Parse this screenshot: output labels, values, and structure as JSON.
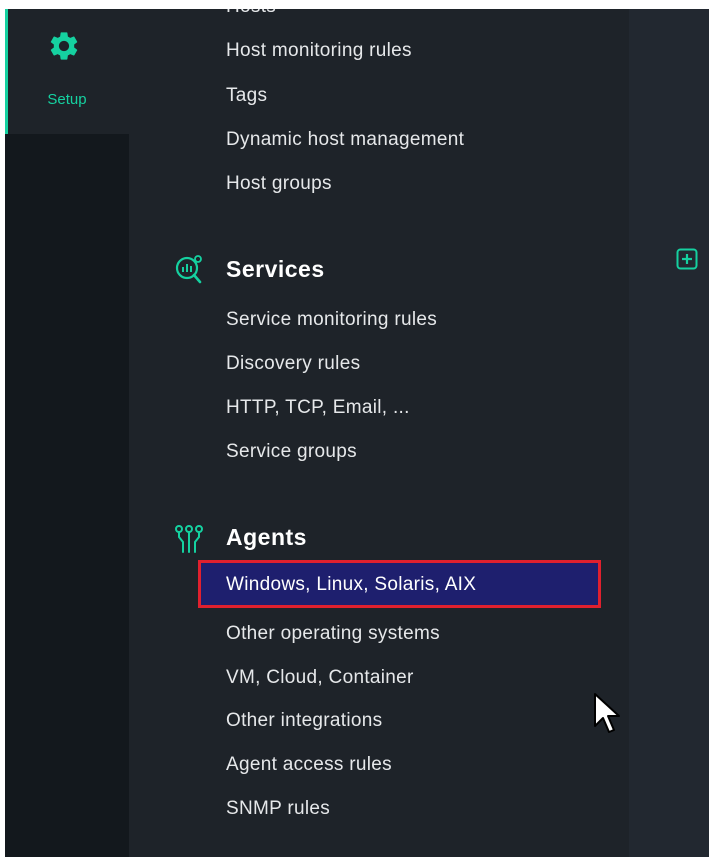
{
  "sidebar": {
    "setup_label": "Setup",
    "setup_icon": "gear-icon",
    "accent_color": "#15d1a0"
  },
  "menu": {
    "hosts_partial": "Hosts",
    "hosts_items": [
      "Host monitoring rules",
      "Tags",
      "Dynamic host management",
      "Host groups"
    ],
    "services": {
      "title": "Services",
      "icon": "services-icon",
      "items": [
        "Service monitoring rules",
        "Discovery rules",
        "HTTP, TCP, Email, ...",
        "Service groups"
      ]
    },
    "agents": {
      "title": "Agents",
      "icon": "agents-icon",
      "items": [
        "Windows, Linux, Solaris, AIX",
        "Other operating systems",
        "VM, Cloud, Container",
        "Other integrations",
        "Agent access rules",
        "SNMP rules"
      ],
      "highlighted_index": 0,
      "highlight_border_color": "#e0202e",
      "highlight_fill_color": "#1e1f6e"
    }
  },
  "right_panel": {
    "add_icon": "add-icon"
  }
}
